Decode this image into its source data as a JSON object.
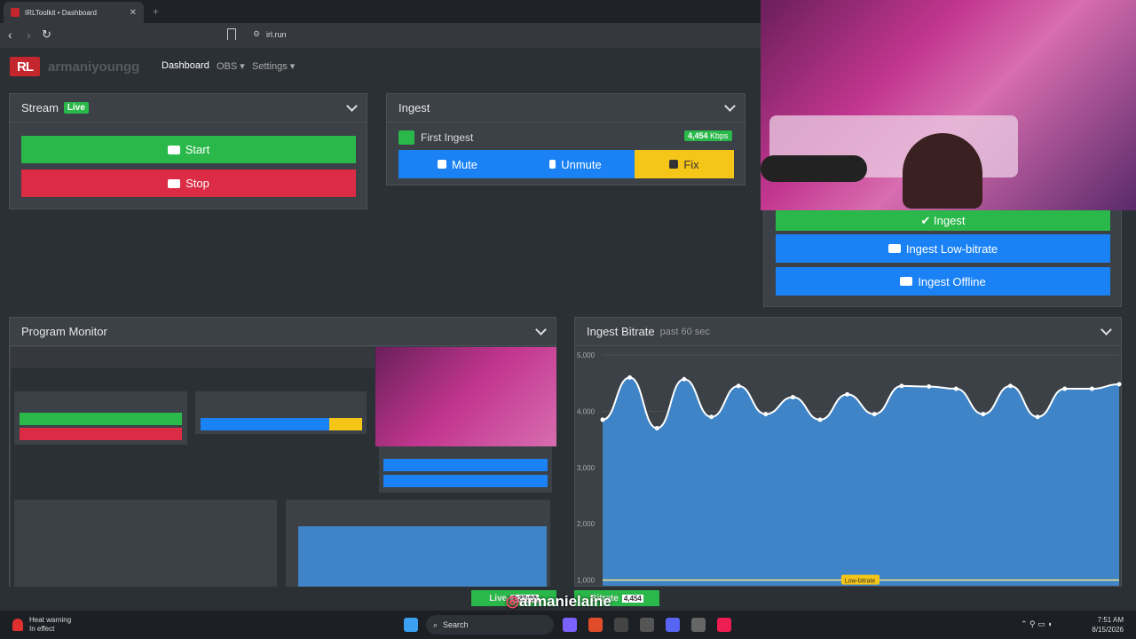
{
  "browser": {
    "tab_title": "IRLToolkit • Dashboard",
    "url": "irl.run"
  },
  "app": {
    "logo": "RL",
    "username": "armaniyoungg",
    "nav": {
      "dashboard": "Dashboard",
      "obs": "OBS ▾",
      "settings": "Settings ▾"
    }
  },
  "stream": {
    "title": "Stream",
    "badge": "Live",
    "start_label": "Start",
    "stop_label": "Stop"
  },
  "ingest": {
    "title": "Ingest",
    "first_ingest": "First Ingest",
    "kbps": "4,454",
    "kbps_unit": "Kbps",
    "mute": "Mute",
    "unmute": "Unmute",
    "fix": "Fix"
  },
  "scenes": {
    "ingest": "✔ Ingest",
    "low": "Ingest Low-bitrate",
    "offline": "Ingest Offline"
  },
  "program_monitor": {
    "title": "Program Monitor"
  },
  "chart_data": {
    "type": "area",
    "title": "Ingest Bitrate",
    "subtitle": "past 60 sec",
    "yticks": [
      "5,000",
      "4,000",
      "3,000",
      "2,000",
      "1,000"
    ],
    "ylim": [
      900,
      5000
    ],
    "values": [
      3850,
      4600,
      3700,
      4570,
      3900,
      4450,
      3950,
      4250,
      3850,
      4300,
      3950,
      4450,
      4440,
      4400,
      3950,
      4450,
      3900,
      4400,
      4400,
      4480
    ],
    "threshold": {
      "value": 1000,
      "label": "Low-bitrate"
    },
    "colors": {
      "fill": "#3f84c6",
      "line": "#ffffff",
      "threshold": "#f5e68a"
    }
  },
  "overlay": {
    "live_label": "Live",
    "live_time": "2:37:03",
    "bitrate_label": "Bitrate",
    "bitrate_value": "4,454",
    "handle": "armanielaine"
  },
  "taskbar": {
    "warn_line1": "Heat warning",
    "warn_line2": "In effect",
    "search": "Search",
    "time": "7:51 AM",
    "date": "8/15/2026"
  }
}
